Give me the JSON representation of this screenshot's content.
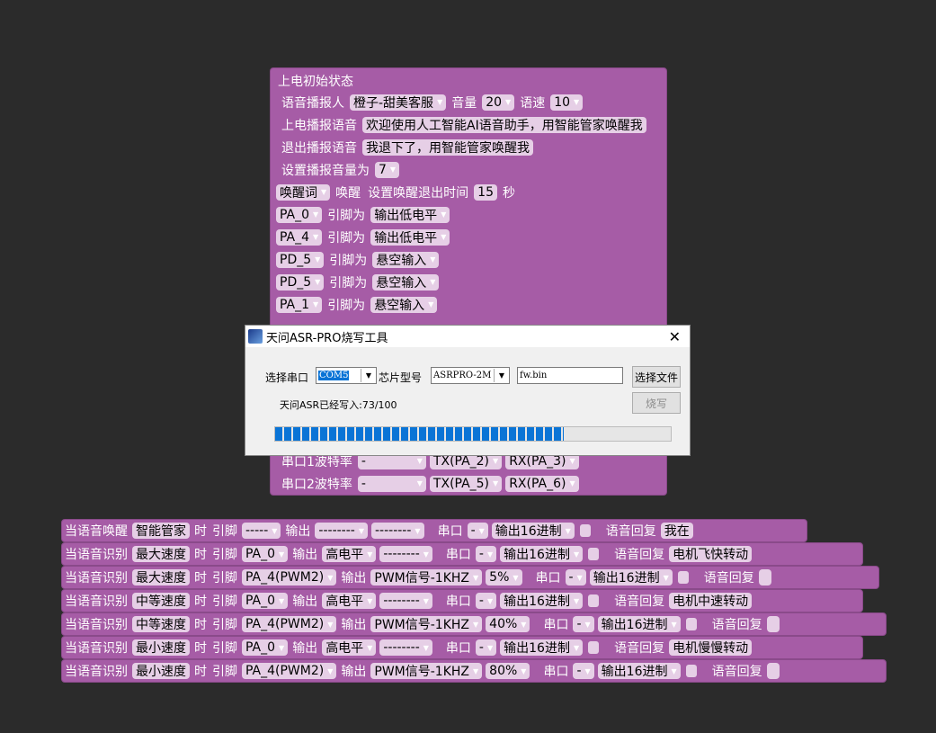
{
  "init_block": {
    "title": "上电初始状态",
    "rows": [
      {
        "parts": [
          {
            "t": "语音播报人"
          },
          {
            "f": "橙子-甜美客服",
            "d": 1
          },
          {
            "t": "音量"
          },
          {
            "f": "20",
            "d": 1
          },
          {
            "t": "语速"
          },
          {
            "f": "10",
            "d": 1
          }
        ]
      },
      {
        "parts": [
          {
            "t": "上电播报语音"
          },
          {
            "f": "欢迎使用人工智能AI语音助手，用智能管家唤醒我"
          }
        ]
      },
      {
        "parts": [
          {
            "t": "退出播报语音"
          },
          {
            "f": "我退下了，用智能管家唤醒我"
          }
        ]
      },
      {
        "parts": [
          {
            "t": "设置播报音量为"
          },
          {
            "f": "7",
            "d": 1
          }
        ]
      },
      {
        "parts": [
          {
            "f": "唤醒词",
            "d": 1
          },
          {
            "t": "唤醒"
          },
          {
            "t": "设置唤醒退出时间"
          },
          {
            "f": "15"
          },
          {
            "t": "秒"
          }
        ]
      },
      {
        "parts": [
          {
            "f": "PA_0",
            "d": 1
          },
          {
            "t": "引脚为"
          },
          {
            "f": "输出低电平",
            "d": 1
          }
        ]
      },
      {
        "parts": [
          {
            "f": "PA_4",
            "d": 1
          },
          {
            "t": "引脚为"
          },
          {
            "f": "输出低电平",
            "d": 1
          }
        ]
      },
      {
        "parts": [
          {
            "f": "PD_5",
            "d": 1
          },
          {
            "t": "引脚为"
          },
          {
            "f": "悬空输入",
            "d": 1
          }
        ]
      },
      {
        "parts": [
          {
            "f": "PD_5",
            "d": 1
          },
          {
            "t": "引脚为"
          },
          {
            "f": "悬空输入",
            "d": 1
          }
        ]
      },
      {
        "parts": [
          {
            "f": "PA_1",
            "d": 1
          },
          {
            "t": "引脚为"
          },
          {
            "f": "悬空输入",
            "d": 1
          }
        ]
      }
    ],
    "uart_rows": [
      {
        "label": "串口1波特率",
        "baud": "-",
        "tx": "TX(PA_2)",
        "rx": "RX(PA_3)"
      },
      {
        "label": "串口2波特率",
        "baud": "-",
        "tx": "TX(PA_5)",
        "rx": "RX(PA_6)"
      }
    ]
  },
  "rules": [
    {
      "head": "当语音唤醒",
      "word": "智能管家",
      "when": "时",
      "pin_label": "引脚",
      "pin": "-----",
      "out_label": "输出",
      "out": "--------",
      "extra": "--------",
      "uart_label": "串口",
      "uart": "-",
      "mode": "输出16进制",
      "reply_label": "语音回复",
      "reply": "我在"
    },
    {
      "head": "当语音识别",
      "word": "最大速度",
      "when": "时",
      "pin_label": "引脚",
      "pin": "PA_0",
      "out_label": "输出",
      "out": "高电平",
      "extra": "--------",
      "uart_label": "串口",
      "uart": "-",
      "mode": "输出16进制",
      "reply_label": "语音回复",
      "reply": "电机飞快转动"
    },
    {
      "head": "当语音识别",
      "word": "最大速度",
      "when": "时",
      "pin_label": "引脚",
      "pin": "PA_4(PWM2)",
      "out_label": "输出",
      "out": "PWM信号-1KHZ",
      "extra": "5%",
      "uart_label": "串口",
      "uart": "-",
      "mode": "输出16进制",
      "reply_label": "语音回复",
      "reply": ""
    },
    {
      "head": "当语音识别",
      "word": "中等速度",
      "when": "时",
      "pin_label": "引脚",
      "pin": "PA_0",
      "out_label": "输出",
      "out": "高电平",
      "extra": "--------",
      "uart_label": "串口",
      "uart": "-",
      "mode": "输出16进制",
      "reply_label": "语音回复",
      "reply": "电机中速转动"
    },
    {
      "head": "当语音识别",
      "word": "中等速度",
      "when": "时",
      "pin_label": "引脚",
      "pin": "PA_4(PWM2)",
      "out_label": "输出",
      "out": "PWM信号-1KHZ",
      "extra": "40%",
      "uart_label": "串口",
      "uart": "-",
      "mode": "输出16进制",
      "reply_label": "语音回复",
      "reply": ""
    },
    {
      "head": "当语音识别",
      "word": "最小速度",
      "when": "时",
      "pin_label": "引脚",
      "pin": "PA_0",
      "out_label": "输出",
      "out": "高电平",
      "extra": "--------",
      "uart_label": "串口",
      "uart": "-",
      "mode": "输出16进制",
      "reply_label": "语音回复",
      "reply": "电机慢慢转动"
    },
    {
      "head": "当语音识别",
      "word": "最小速度",
      "when": "时",
      "pin_label": "引脚",
      "pin": "PA_4(PWM2)",
      "out_label": "输出",
      "out": "PWM信号-1KHZ",
      "extra": "80%",
      "uart_label": "串口",
      "uart": "-",
      "mode": "输出16进制",
      "reply_label": "语音回复",
      "reply": ""
    }
  ],
  "dialog": {
    "title": "天问ASR-PRO烧写工具",
    "close_glyph": "✕",
    "port_label": "选择串口",
    "port_value": "COM5",
    "chip_label": "芯片型号",
    "chip_value": "ASRPRO-2M",
    "file_value": "fw.bin",
    "choose_file_label": "选择文件",
    "status_text": "天问ASR已经写入:73/100",
    "burn_label": "烧写",
    "progress": 0.73
  },
  "colors": {
    "block": "#a65ca6",
    "background": "#2b2b2b",
    "progress": "#0a74d6"
  }
}
